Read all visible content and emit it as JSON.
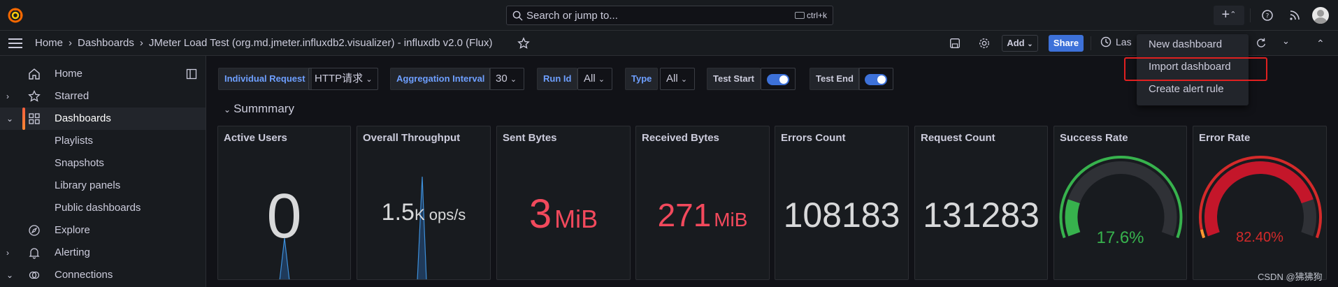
{
  "topbar": {
    "search_placeholder": "Search or jump to...",
    "search_shortcut": "ctrl+k"
  },
  "breadcrumb": {
    "items": [
      "Home",
      "Dashboards"
    ],
    "current": "JMeter Load Test (org.md.jmeter.influxdb2.visualizer) - influxdb v2.0 (Flux)"
  },
  "toolbar": {
    "add_label": "Add",
    "share_label": "Share",
    "time_label": "Las"
  },
  "sidebar": {
    "items": [
      {
        "label": "Home",
        "icon": "home-icon"
      },
      {
        "label": "Starred",
        "icon": "star-icon"
      },
      {
        "label": "Dashboards",
        "icon": "apps-icon"
      },
      {
        "label": "Playlists"
      },
      {
        "label": "Snapshots"
      },
      {
        "label": "Library panels"
      },
      {
        "label": "Public dashboards"
      },
      {
        "label": "Explore",
        "icon": "compass-icon"
      },
      {
        "label": "Alerting",
        "icon": "bell-icon"
      },
      {
        "label": "Connections",
        "icon": "link-icon"
      }
    ]
  },
  "variables": {
    "individual_request": {
      "label": "Individual Request",
      "value": "HTTP请求"
    },
    "aggregation_interval": {
      "label": "Aggregation Interval",
      "value": "30"
    },
    "run_id": {
      "label": "Run Id",
      "value": "All"
    },
    "type": {
      "label": "Type",
      "value": "All"
    },
    "test_start": {
      "label": "Test Start"
    },
    "test_end": {
      "label": "Test End"
    }
  },
  "row": {
    "title": "Summmary"
  },
  "panels": [
    {
      "title": "Active Users",
      "value": "0",
      "unit": ""
    },
    {
      "title": "Overall Throughput",
      "value": "1.5",
      "unit": "K ops/s"
    },
    {
      "title": "Sent Bytes",
      "value": "3",
      "unit": "MiB"
    },
    {
      "title": "Received Bytes",
      "value": "271",
      "unit": "MiB"
    },
    {
      "title": "Errors Count",
      "value": "108183",
      "unit": ""
    },
    {
      "title": "Request Count",
      "value": "131283",
      "unit": ""
    },
    {
      "title": "Success Rate",
      "value": "17.6%",
      "unit": "",
      "gauge_fraction": 0.176
    },
    {
      "title": "Error Rate",
      "value": "82.40%",
      "unit": "",
      "gauge_fraction": 0.824
    }
  ],
  "menu": {
    "items": [
      "New dashboard",
      "Import dashboard",
      "Create alert rule"
    ]
  },
  "watermark": "CSDN @狒狒狗",
  "colors": {
    "accent_blue": "#3d71d9",
    "value_red": "#f2495c",
    "gauge_green": "#37872d",
    "gauge_red": "#c4162a",
    "highlight_red": "#e02020"
  }
}
